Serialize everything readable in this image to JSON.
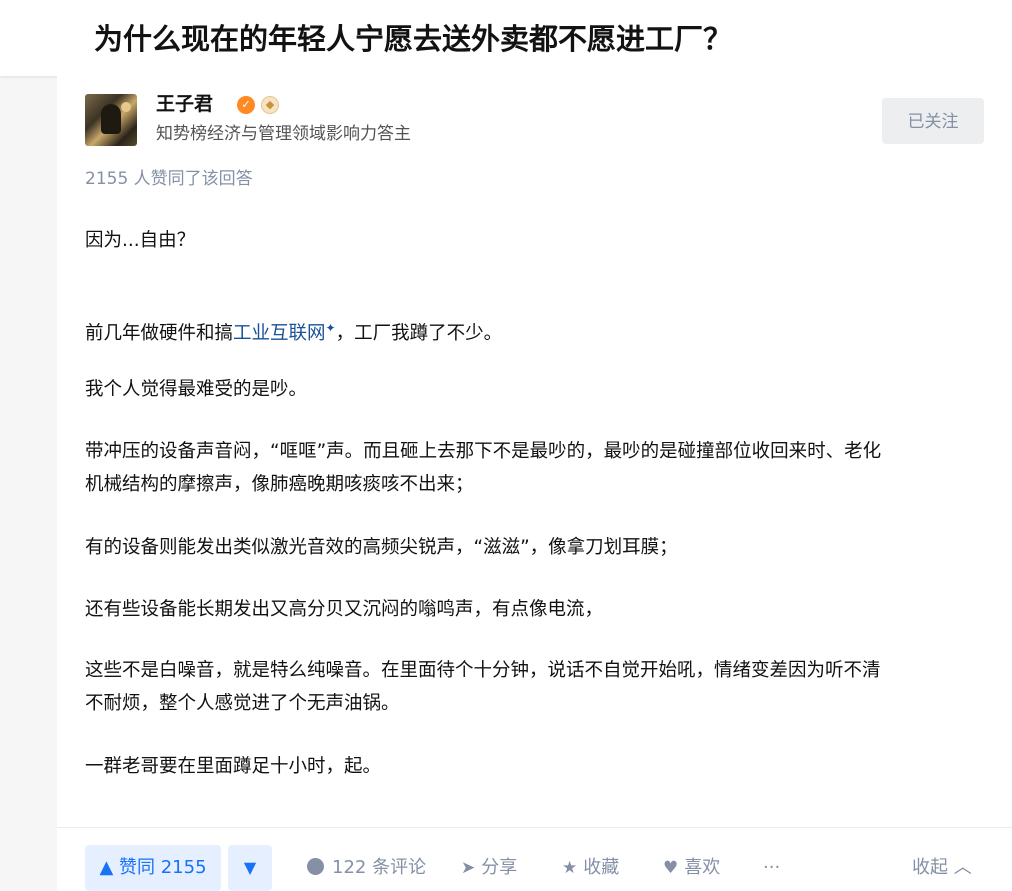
{
  "question": {
    "title": "为什么现在的年轻人宁愿去送外卖都不愿进工厂？"
  },
  "author": {
    "name": "王子君",
    "headline": "知势榜经济与管理领域影响力答主",
    "follow_label": "已关注"
  },
  "answer": {
    "vote_summary": "2155 人赞同了该回答",
    "paragraphs": {
      "p1": "因为...自由？",
      "p2_before": "前几年做硬件和搞",
      "p2_link": "工业互联网",
      "p2_after": "，工厂我蹲了不少。",
      "p3": "我个人觉得最难受的是吵。",
      "p4_line1": "带冲压的设备声音闷，“哐哐”声。而且砸上去那下不是最吵的，最吵的是碰撞部位收回来时、老化",
      "p4_line2": "机械结构的摩擦声，像肺癌晚期咳痰咳不出来；",
      "p5": "有的设备则能发出类似激光音效的高频尖锐声，“滋滋”，像拿刀划耳膜；",
      "p6": "还有些设备能长期发出又高分贝又沉闷的嗡鸣声，有点像电流，",
      "p7_line1": "这些不是白噪音，就是特么纯噪音。在里面待个十分钟，说话不自觉开始吼，情绪变差因为听不清",
      "p7_line2": "不耐烦，整个人感觉进了个无声油锅。",
      "p8": "一群老哥要在里面蹲足十小时，起。"
    }
  },
  "actions": {
    "vote_up": "▲ 赞同 2155",
    "vote_down": "▼",
    "comments": "122 条评论",
    "share": "分享",
    "favorite": "收藏",
    "like": "喜欢",
    "more": "···",
    "collapse": "收起 ︿"
  },
  "icons": {
    "link_spark": "✦",
    "share": "share-icon",
    "star": "star-icon",
    "heart": "heart-icon",
    "comment": "comment-icon"
  }
}
